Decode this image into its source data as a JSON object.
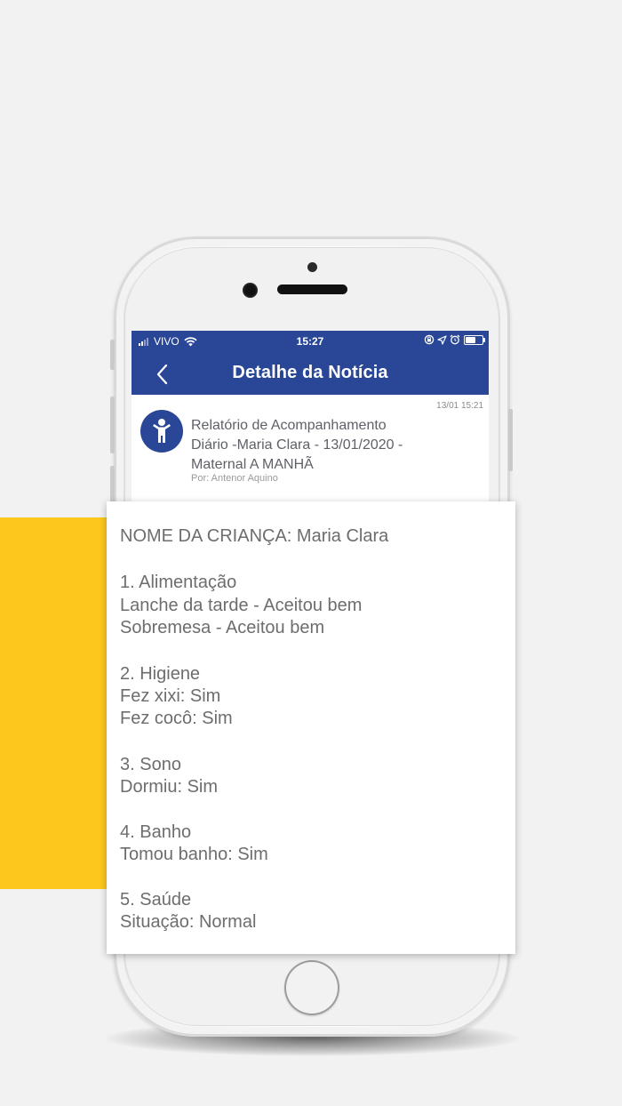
{
  "status_bar": {
    "carrier": "VIVO",
    "time": "15:27"
  },
  "nav": {
    "title": "Detalhe da Notícia"
  },
  "news": {
    "timestamp": "13/01 15:21",
    "title_lines": [
      "Relatório de Acompanhamento",
      "Diário -Maria Clara - 13/01/2020 -",
      "Maternal A MANHÃ"
    ],
    "author": "Por: Antenor Aquino"
  },
  "report": {
    "child_name_line": "NOME DA CRIANÇA: Maria Clara",
    "sections": [
      {
        "heading": "1. Alimentação",
        "items": [
          "Lanche da tarde - Aceitou bem",
          "Sobremesa  - Aceitou bem"
        ]
      },
      {
        "heading": "2. Higiene",
        "items": [
          "Fez xixi: Sim",
          "Fez cocô: Sim"
        ]
      },
      {
        "heading": "3. Sono",
        "items": [
          "Dormiu: Sim"
        ]
      },
      {
        "heading": "4. Banho",
        "items": [
          "Tomou banho: Sim"
        ]
      },
      {
        "heading": "5. Saúde",
        "items": [
          "Situação: Normal"
        ]
      }
    ]
  },
  "colors": {
    "brand_blue": "#2a4797",
    "accent_yellow": "#fcc81c"
  },
  "icons": [
    "signal-icon",
    "wifi-icon",
    "rotation-lock-icon",
    "location-icon",
    "alarm-icon",
    "battery-icon",
    "back-chevron-icon",
    "child-icon"
  ]
}
